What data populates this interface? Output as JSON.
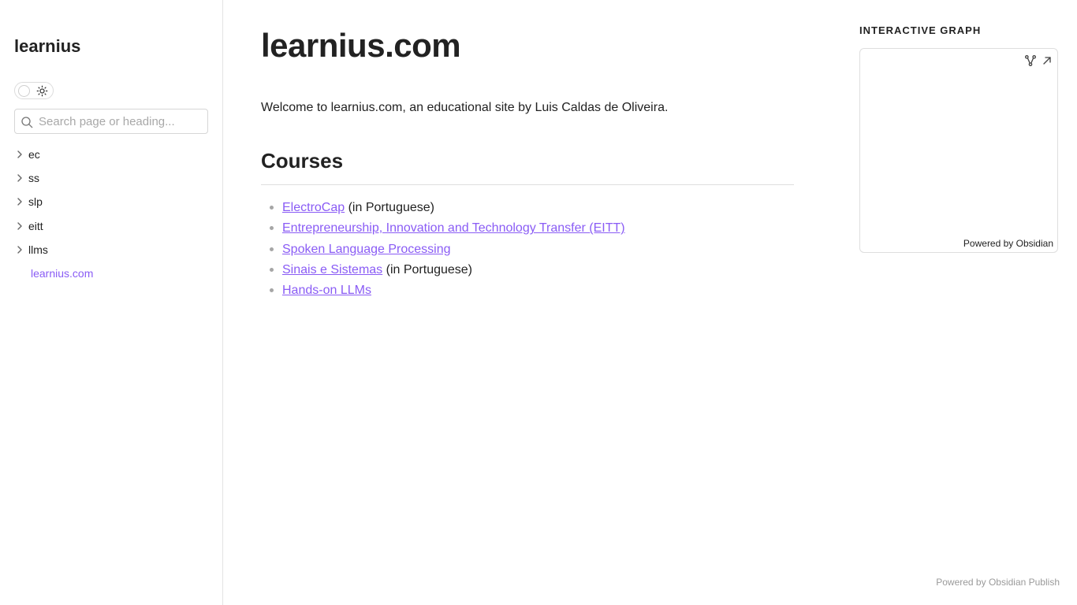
{
  "sidebar": {
    "site_name": "learnius",
    "search_placeholder": "Search page or heading...",
    "items": [
      {
        "label": "ec"
      },
      {
        "label": "ss"
      },
      {
        "label": "slp"
      },
      {
        "label": "eitt"
      },
      {
        "label": "llms"
      }
    ],
    "active_item": "learnius.com"
  },
  "main": {
    "title": "learnius.com",
    "intro": "Welcome to learnius.com, an educational site by Luis Caldas de Oliveira.",
    "courses_heading": "Courses",
    "courses": [
      {
        "link": "ElectroCap",
        "suffix": " (in Portuguese)"
      },
      {
        "link": "Entrepreneurship, Innovation and Technology Transfer (EITT)",
        "suffix": ""
      },
      {
        "link": "Spoken Language Processing",
        "suffix": ""
      },
      {
        "link": "Sinais e Sistemas",
        "suffix": " (in Portuguese)"
      },
      {
        "link": "Hands-on LLMs",
        "suffix": ""
      }
    ]
  },
  "graph": {
    "title": "INTERACTIVE GRAPH",
    "powered": "Powered by Obsidian",
    "icons": [
      "global-graph-icon",
      "expand-icon"
    ]
  },
  "footer": {
    "text": "Powered by Obsidian Publish"
  },
  "colors": {
    "accent": "#8a5cf5",
    "text": "#222222",
    "muted": "#9a9a9a",
    "border": "#e3e3e3"
  }
}
